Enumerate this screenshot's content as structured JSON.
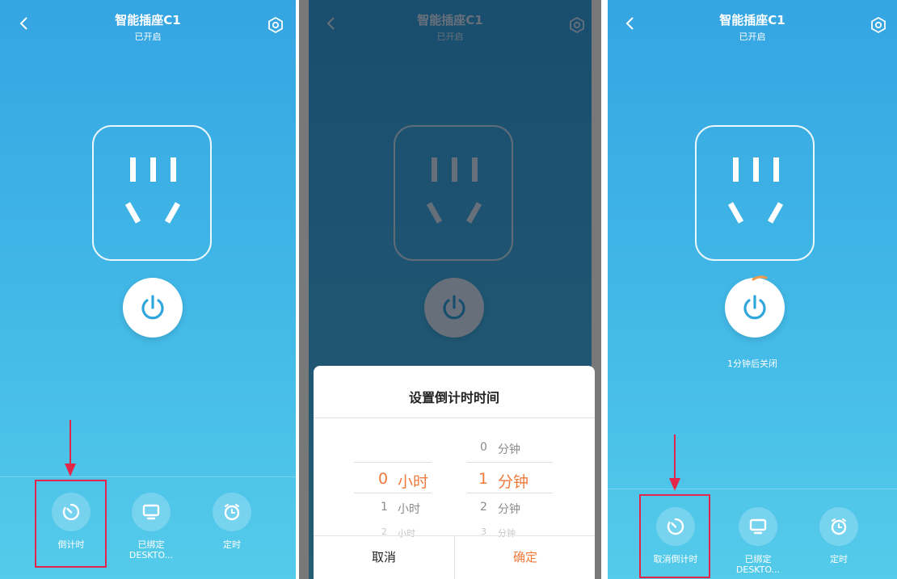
{
  "device": {
    "title": "智能插座C1",
    "status": "已开启"
  },
  "toolbar": {
    "countdown_label": "倒计时",
    "cancel_countdown_label": "取消倒计时",
    "bound_label": "已绑定",
    "bound_device": "DESKTO...",
    "schedule_label": "定时"
  },
  "dialog": {
    "title": "设置倒计时时间",
    "hour_unit": "小时",
    "minute_unit": "分钟",
    "hours": {
      "selected": "0",
      "next": "1",
      "after_next": "2"
    },
    "minutes": {
      "prev": "0",
      "selected": "1",
      "next": "2",
      "after_next": "3"
    },
    "cancel_label": "取消",
    "confirm_label": "确定"
  },
  "countdown_status": "1分钟后关闭",
  "colors": {
    "accent_orange": "#ef7a3b",
    "highlight_red": "#e3254b",
    "power_blue": "#2fa6dc",
    "background_blue": "#35a5e2"
  }
}
